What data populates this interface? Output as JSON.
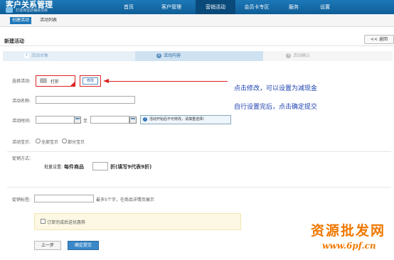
{
  "brand": {
    "title": "客户关系管理",
    "subtitle": "打造淘宝店铺会员库"
  },
  "nav": {
    "items": [
      {
        "label": "首页",
        "w": 52,
        "active": false
      },
      {
        "label": "客户管理",
        "w": 68,
        "active": false
      },
      {
        "label": "营销活动",
        "w": 56,
        "active": true
      },
      {
        "label": "会员卡专区",
        "w": 60,
        "active": false
      },
      {
        "label": "服务",
        "w": 44,
        "active": false
      },
      {
        "label": "设置",
        "w": 44,
        "active": false
      }
    ]
  },
  "subnav": {
    "tabs": [
      {
        "label": "创建活动",
        "active": true
      },
      {
        "label": "活动列表",
        "active": false
      }
    ]
  },
  "page": {
    "title": "新建活动",
    "back_label": "<< 返回"
  },
  "steps": [
    {
      "num": "1",
      "label": "活动对象"
    },
    {
      "num": "2",
      "label": "活动内容"
    },
    {
      "num": "3",
      "label": "活动确认"
    }
  ],
  "form": {
    "choose_label": "选择活动:",
    "choose_value": "打折",
    "modify_label": "修改",
    "name_label": "活动名称:",
    "time_label": "活动时间:",
    "time_to": "至",
    "time_hint": "活动开始后不可修改，请慎重选择!",
    "product_label": "活动宝贝:",
    "product_options": [
      "全部宝贝",
      "部分宝贝"
    ],
    "method_label": "促销方式:",
    "bulk_prefix": "批量设置:",
    "bulk_each": "每件商品",
    "bulk_suffix": "折(填写9代表9折)",
    "tag_label": "促销标签:",
    "tag_hint": "最多5个字，在商品详情页展示",
    "coupon_label": "订单完成后送优惠券",
    "prev_button": "上一步",
    "submit_button": "确定提交"
  },
  "annotations": {
    "line1": "点击修改，可以设置为减现金",
    "line2": "自行设置完后，点击确定提交"
  },
  "watermark": {
    "text": "资源批发网",
    "url": "www.6pf.cn"
  },
  "colors": {
    "accent": "#1d78b8",
    "callout": "#dd2222",
    "note_text": "#1a3faf",
    "watermark": "#f07800"
  }
}
